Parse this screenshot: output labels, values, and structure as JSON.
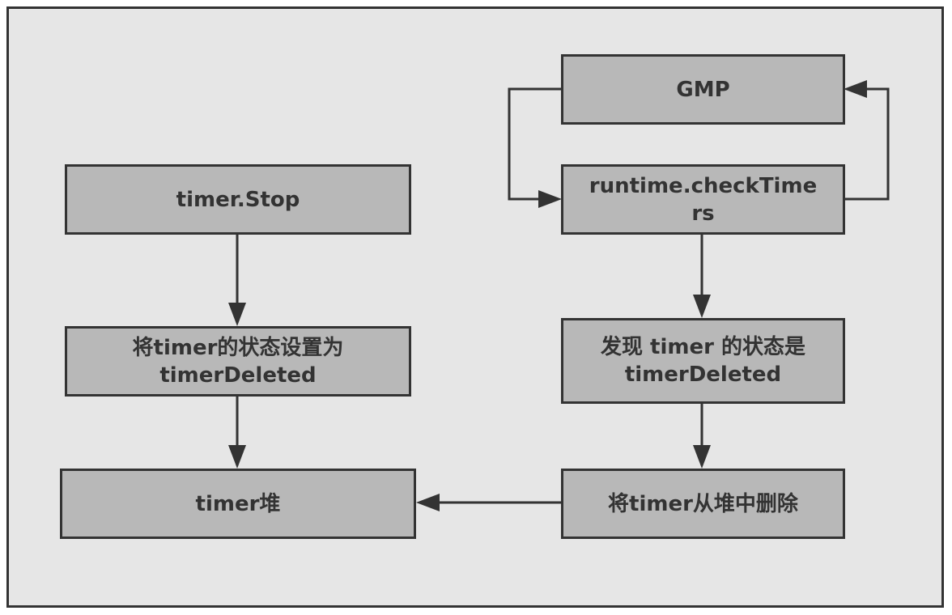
{
  "diagram": {
    "nodes": {
      "gmp": "GMP",
      "check_timers": "runtime.checkTime\nrs",
      "timer_stop": "timer.Stop",
      "set_deleted": "将timer的状态设置为\ntimerDeleted",
      "timer_heap": "timer堆",
      "found_deleted": "发现 timer 的状态是\ntimerDeleted",
      "remove_from_heap": "将timer从堆中删除"
    },
    "edges": [
      {
        "from": "timer_stop",
        "to": "set_deleted"
      },
      {
        "from": "set_deleted",
        "to": "timer_heap"
      },
      {
        "from": "gmp",
        "to": "check_timers"
      },
      {
        "from": "check_timers",
        "to": "gmp"
      },
      {
        "from": "check_timers",
        "to": "found_deleted"
      },
      {
        "from": "found_deleted",
        "to": "remove_from_heap"
      },
      {
        "from": "remove_from_heap",
        "to": "timer_heap"
      }
    ],
    "colors": {
      "background": "#e6e6e6",
      "node_fill": "#b8b8b8",
      "stroke": "#333333"
    }
  }
}
